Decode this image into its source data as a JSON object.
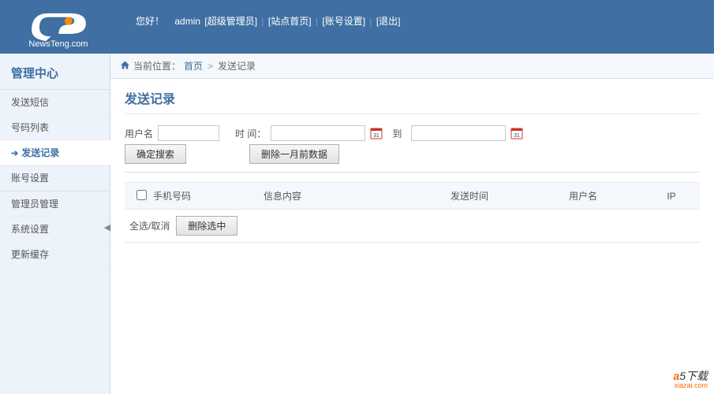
{
  "logo": {
    "brand": "NewsTeng.com"
  },
  "header": {
    "greeting": "您好！",
    "user": "admin",
    "role": "[超级管理员]",
    "links": {
      "site_home": "[站点首页]",
      "account_settings": "[账号设置]",
      "logout": "[退出]"
    }
  },
  "sidebar": {
    "title": "管理中心",
    "items": [
      {
        "label": "发送短信"
      },
      {
        "label": "号码列表"
      },
      {
        "label": "发送记录",
        "active": true
      },
      {
        "label": "账号设置"
      },
      {
        "label": "管理员管理",
        "group_break": true
      },
      {
        "label": "系统设置"
      },
      {
        "label": "更新缓存"
      }
    ]
  },
  "breadcrumb": {
    "label": "当前位置：",
    "home": "首页",
    "current": "发送记录"
  },
  "page": {
    "title": "发送记录",
    "filters": {
      "user_label": "用户名",
      "time_label": "时 间：",
      "to_label": "到"
    },
    "buttons": {
      "search": "确定搜索",
      "delete_month": "删除一月前数据",
      "select_all": "全选/取消",
      "delete_selected": "删除选中"
    },
    "columns": {
      "phone": "手机号码",
      "content": "信息内容",
      "time": "发送时间",
      "user": "用户名",
      "ip": "IP"
    }
  },
  "watermark": {
    "main": "a5下载",
    "sub": "xiazai.com"
  }
}
